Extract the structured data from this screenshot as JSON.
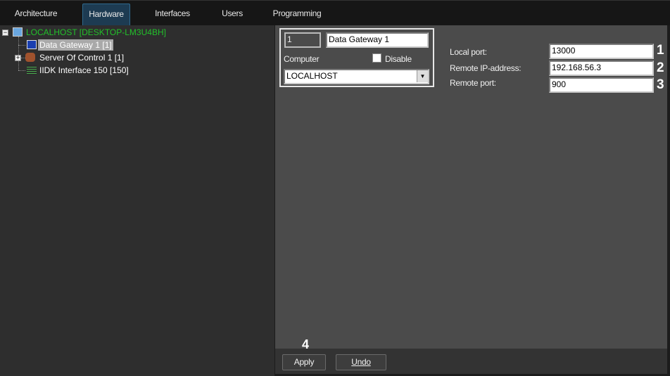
{
  "tabs": [
    {
      "label": "Architecture"
    },
    {
      "label": "Hardware",
      "active": true
    },
    {
      "label": "Interfaces"
    },
    {
      "label": "Users"
    },
    {
      "label": "Programming"
    }
  ],
  "tree": {
    "root": {
      "label": "LOCALHOST [DESKTOP-LM3U4BH]",
      "color": "#22c02a"
    },
    "children": [
      {
        "label": "Data Gateway 1 [1]",
        "selected": true
      },
      {
        "label": "Server Of Control 1 [1]"
      },
      {
        "label": "IIDK Interface 150 [150]"
      }
    ]
  },
  "object": {
    "id": "1",
    "name": "Data Gateway 1",
    "computer_label": "Computer",
    "disable_label": "Disable",
    "disable_checked": false,
    "computer_value": "LOCALHOST"
  },
  "settings": [
    {
      "label": "Local port:",
      "value": "13000",
      "marker": "1"
    },
    {
      "label": "Remote IP-address:",
      "value": "192.168.56.3",
      "marker": "2"
    },
    {
      "label": "Remote port:",
      "value": "900",
      "marker": "3"
    }
  ],
  "footer": {
    "marker": "4",
    "apply": "Apply",
    "undo": "Undo"
  }
}
